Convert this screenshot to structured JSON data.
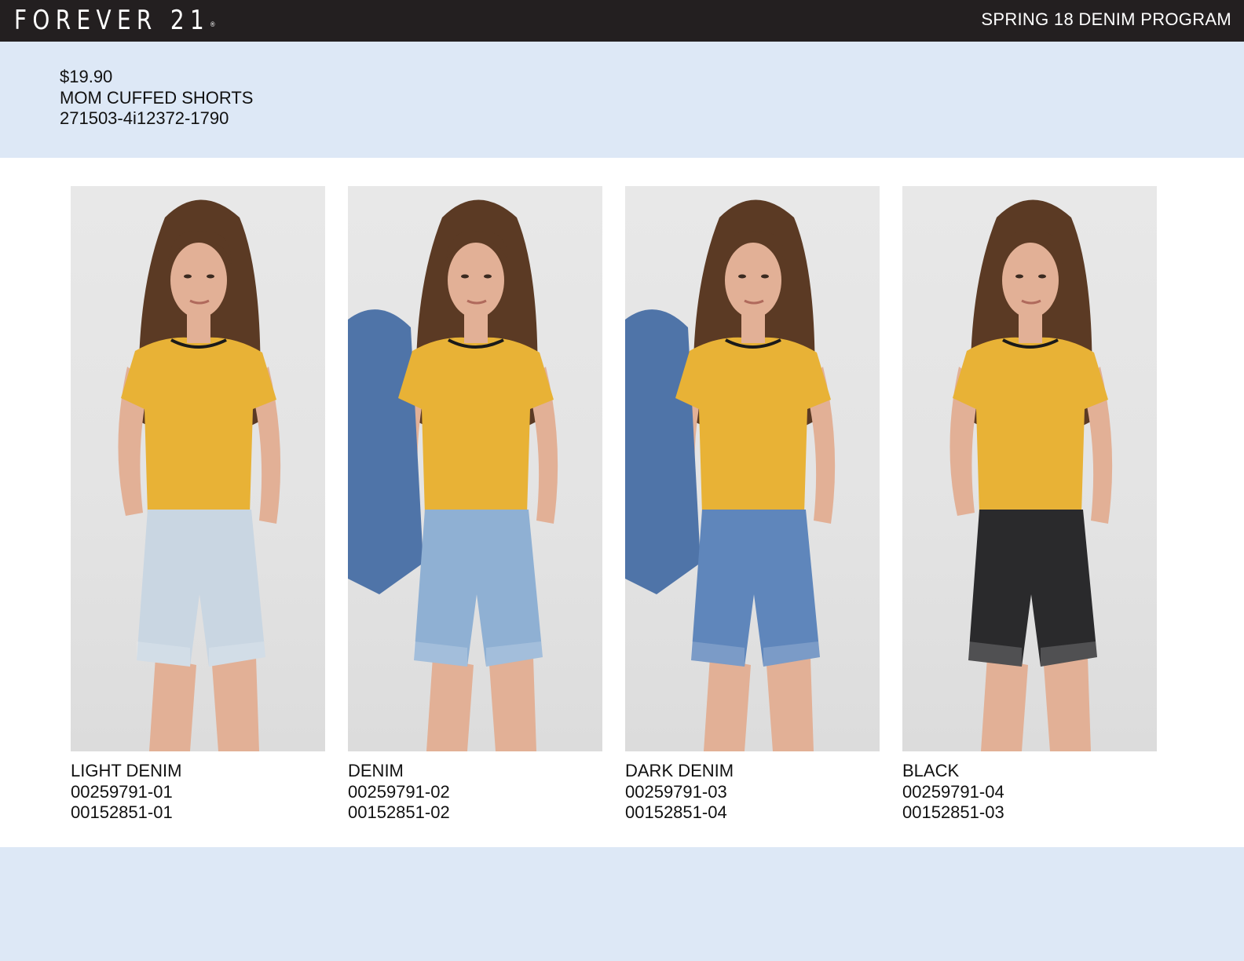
{
  "header": {
    "brand": "FOREVER 21",
    "brand_mark": "®",
    "program": "SPRING 18 DENIM PROGRAM"
  },
  "product": {
    "price": "$19.90",
    "name": "MOM CUFFED SHORTS",
    "style_number": "271503-4i12372-1790"
  },
  "variants": [
    {
      "color": "LIGHT DENIM",
      "code_1": "00259791-01",
      "code_2": "00152851-01",
      "shorts_color": "#c9d6e2",
      "jacket": false
    },
    {
      "color": "DENIM",
      "code_1": "00259791-02",
      "code_2": "00152851-02",
      "shorts_color": "#8fb0d3",
      "jacket": true
    },
    {
      "color": "DARK DENIM",
      "code_1": "00259791-03",
      "code_2": "00152851-04",
      "shorts_color": "#5f86bb",
      "jacket": true
    },
    {
      "color": "BLACK",
      "code_1": "00259791-04",
      "code_2": "00152851-03",
      "shorts_color": "#2a2a2c",
      "jacket": false
    }
  ],
  "colors": {
    "header_bg": "#231f20",
    "band_bg": "#dde8f6",
    "tee": "#e8b236",
    "hair": "#5b3a24",
    "skin": "#e2b096"
  }
}
